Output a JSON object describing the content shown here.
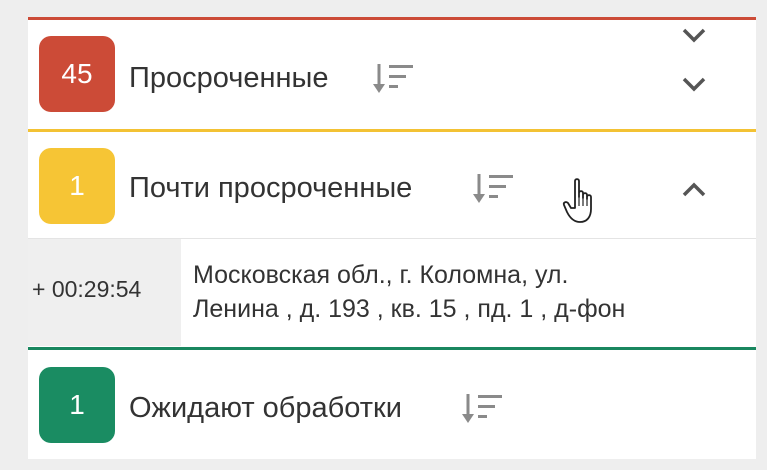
{
  "groups": [
    {
      "count": "45",
      "label": "Просроченные",
      "color": "#cc4b37",
      "expanded": false,
      "sort_icon": "sort-descending-icon",
      "toggle_icon": "chevron-down-icon"
    },
    {
      "count": "1",
      "label": "Почти просроченные",
      "color": "#f6c535",
      "expanded": true,
      "sort_icon": "sort-descending-icon",
      "toggle_icon": "chevron-up-icon"
    },
    {
      "count": "1",
      "label": "Ожидают обработки",
      "color": "#1a8c62",
      "expanded": false,
      "sort_icon": "sort-descending-icon",
      "toggle_icon": "chevron-down-icon"
    }
  ],
  "order": {
    "timer": "+ 00:29:54",
    "address_line1": "Московская обл., г. Коломна, ул.",
    "address_line2": "Ленина , д. 193 , кв. 15 , пд. 1 , д-фон"
  },
  "cursor_icon": "hand-pointer-icon"
}
